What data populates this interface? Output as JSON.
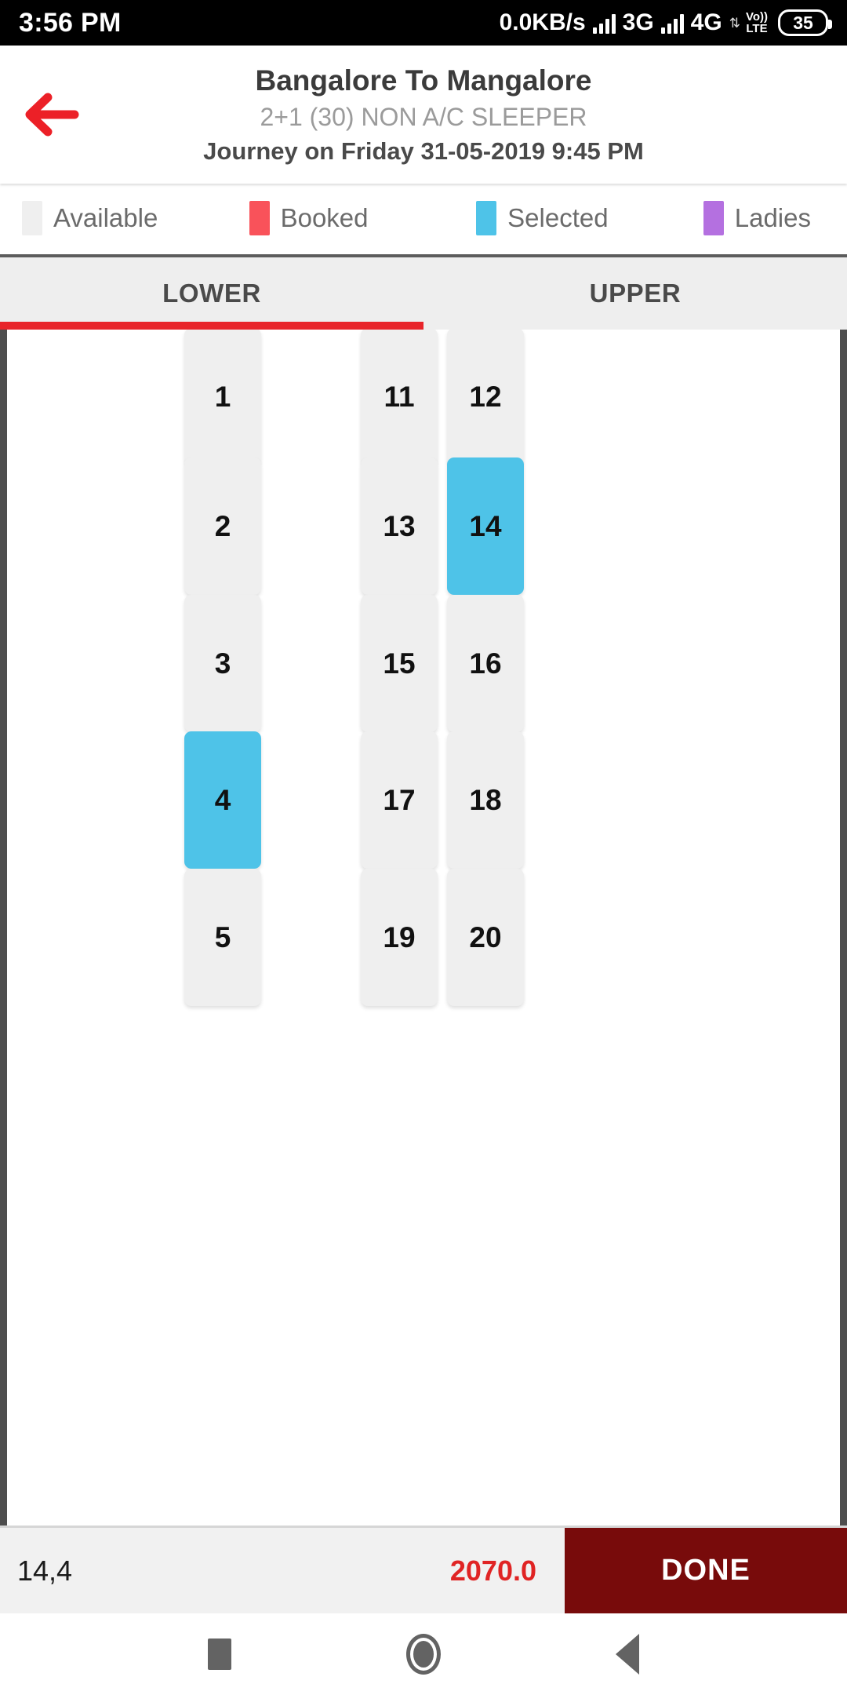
{
  "status_bar": {
    "time": "3:56 PM",
    "network_speed": "0.0KB/s",
    "network_1": "3G",
    "network_2": "4G",
    "volte_top": "Vo))",
    "volte_bottom": "LTE",
    "battery": "35"
  },
  "header": {
    "back_icon": "back-arrow-icon",
    "title": "Bangalore To Mangalore",
    "subtitle": "2+1 (30) NON A/C SLEEPER",
    "journey": "Journey on Friday 31-05-2019  9:45 PM"
  },
  "legend": {
    "items": [
      {
        "label": "Available",
        "color": "#efefef"
      },
      {
        "label": "Booked",
        "color": "#f9525a"
      },
      {
        "label": "Selected",
        "color": "#4ec3e8"
      },
      {
        "label": "Ladies",
        "color": "#b470e0"
      }
    ]
  },
  "tabs": {
    "items": [
      {
        "label": "LOWER",
        "active": true
      },
      {
        "label": "UPPER",
        "active": false
      }
    ],
    "indicator_color": "#e8242a"
  },
  "seat_map": {
    "deck": "LOWER",
    "seats": [
      {
        "number": "1",
        "state": "available",
        "col": 1,
        "row": 1
      },
      {
        "number": "11",
        "state": "available",
        "col": 2,
        "row": 1
      },
      {
        "number": "12",
        "state": "available",
        "col": 3,
        "row": 1
      },
      {
        "number": "2",
        "state": "available",
        "col": 1,
        "row": 2
      },
      {
        "number": "13",
        "state": "available",
        "col": 2,
        "row": 2
      },
      {
        "number": "14",
        "state": "selected",
        "col": 3,
        "row": 2
      },
      {
        "number": "3",
        "state": "available",
        "col": 1,
        "row": 3
      },
      {
        "number": "15",
        "state": "available",
        "col": 2,
        "row": 3
      },
      {
        "number": "16",
        "state": "available",
        "col": 3,
        "row": 3
      },
      {
        "number": "4",
        "state": "selected",
        "col": 1,
        "row": 4
      },
      {
        "number": "17",
        "state": "available",
        "col": 2,
        "row": 4
      },
      {
        "number": "18",
        "state": "available",
        "col": 3,
        "row": 4
      },
      {
        "number": "5",
        "state": "available",
        "col": 1,
        "row": 5
      },
      {
        "number": "19",
        "state": "available",
        "col": 2,
        "row": 5
      },
      {
        "number": "20",
        "state": "available",
        "col": 3,
        "row": 5
      }
    ]
  },
  "bottom_bar": {
    "selected_seats": "14,4",
    "total_price": "2070.0",
    "done_label": "DONE",
    "done_bg": "#780b0b",
    "price_color": "#e02424"
  },
  "nav_bar": {
    "recents": "square-icon",
    "home": "circle-icon",
    "back": "triangle-back-icon"
  }
}
